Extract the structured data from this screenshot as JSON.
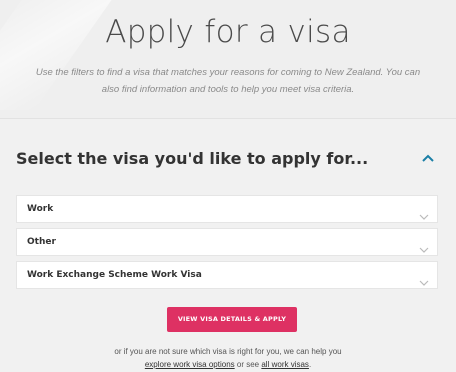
{
  "hero": {
    "title": "Apply for a visa",
    "subtitle": "Use the filters to find a visa that matches your reasons for coming to New Zealand. You can also find information and tools to help you meet visa criteria."
  },
  "section": {
    "heading": "Select the visa you'd like to apply for..."
  },
  "selects": [
    {
      "value": "Work"
    },
    {
      "value": "Other"
    },
    {
      "value": "Work Exchange Scheme Work Visa"
    }
  ],
  "cta": {
    "label": "VIEW VISA DETAILS & APPLY",
    "color": "#de3163"
  },
  "help": {
    "line1": "or if you are not sure which visa is right for you, we can help you",
    "link1": "explore work visa options",
    "middle": "or see",
    "link2": "all work visas",
    "end": "."
  },
  "icons": {
    "collapse": "chevron-up-icon",
    "dropdown": "chevron-down-icon"
  }
}
